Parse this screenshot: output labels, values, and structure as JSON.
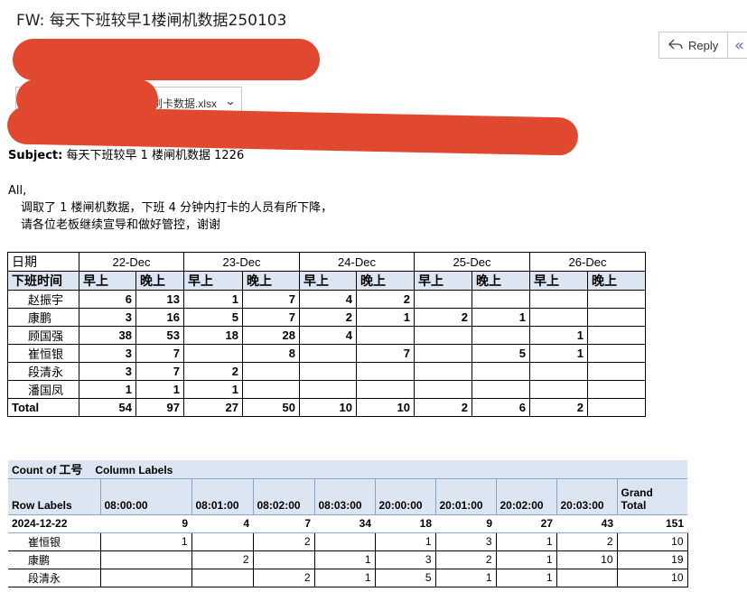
{
  "email": {
    "title": "FW: 每天下班较早1楼闸机数据250103",
    "reply_label": "Reply",
    "reply_all_icon": "«",
    "attachment_name": "刷卡数据.xlsx",
    "subject_label": "Subject:",
    "subject_text": "每天下班较早 1 楼闸机数据 1226",
    "greeting": "All,",
    "line1": "调取了 1 楼闸机数据，下班 4 分钟内打卡的人员有所下降，",
    "line2": "请各位老板继续宣导和做好管控，谢谢"
  },
  "table1": {
    "date_label": "日期",
    "dates": [
      "22-Dec",
      "23-Dec",
      "24-Dec",
      "25-Dec",
      "26-Dec"
    ],
    "time_label": "下班时间",
    "subheaders": [
      "早上",
      "晚上",
      "早上",
      "晚上",
      "早上",
      "晚上",
      "早上",
      "晚上",
      "早上",
      "晚上"
    ],
    "rows": [
      {
        "name": "赵振宇",
        "values": [
          "6",
          "13",
          "1",
          "7",
          "4",
          "2",
          "",
          "",
          "",
          ""
        ]
      },
      {
        "name": "康鹏",
        "values": [
          "3",
          "16",
          "5",
          "7",
          "2",
          "1",
          "2",
          "1",
          "",
          ""
        ]
      },
      {
        "name": "顾国强",
        "values": [
          "38",
          "53",
          "18",
          "28",
          "4",
          "",
          "",
          "",
          "1",
          ""
        ]
      },
      {
        "name": "崔恒银",
        "values": [
          "3",
          "7",
          "",
          "8",
          "",
          "7",
          "",
          "5",
          "1",
          ""
        ]
      },
      {
        "name": "段清永",
        "values": [
          "3",
          "7",
          "2",
          "",
          "",
          "",
          "",
          "",
          "",
          ""
        ]
      },
      {
        "name": "潘国凤",
        "values": [
          "1",
          "1",
          "1",
          "",
          "",
          "",
          "",
          "",
          "",
          ""
        ]
      }
    ],
    "total_label": "Total",
    "totals": [
      "54",
      "97",
      "27",
      "50",
      "10",
      "10",
      "2",
      "6",
      "2",
      ""
    ]
  },
  "pivot": {
    "count_label": "Count of",
    "count_field": "工号",
    "column_labels": "Column Labels",
    "row_labels": "Row Labels",
    "times": [
      "08:00:00",
      "08:01:00",
      "08:02:00",
      "08:03:00",
      "20:00:00",
      "20:01:00",
      "20:02:00",
      "20:03:00"
    ],
    "grand_total_line1": "Grand",
    "grand_total_line2": "Total",
    "group": {
      "label": "2024-12-22",
      "values": [
        "9",
        "4",
        "7",
        "34",
        "18",
        "9",
        "27",
        "43",
        "151"
      ]
    },
    "rows": [
      {
        "name": "崔恒银",
        "values": [
          "1",
          "",
          "2",
          "",
          "1",
          "3",
          "1",
          "2",
          "10"
        ]
      },
      {
        "name": "康鹏",
        "values": [
          "",
          "2",
          "",
          "1",
          "3",
          "2",
          "1",
          "10",
          "19"
        ]
      },
      {
        "name": "段清永",
        "values": [
          "",
          "",
          "2",
          "1",
          "5",
          "1",
          "1",
          "",
          "10"
        ]
      }
    ]
  }
}
